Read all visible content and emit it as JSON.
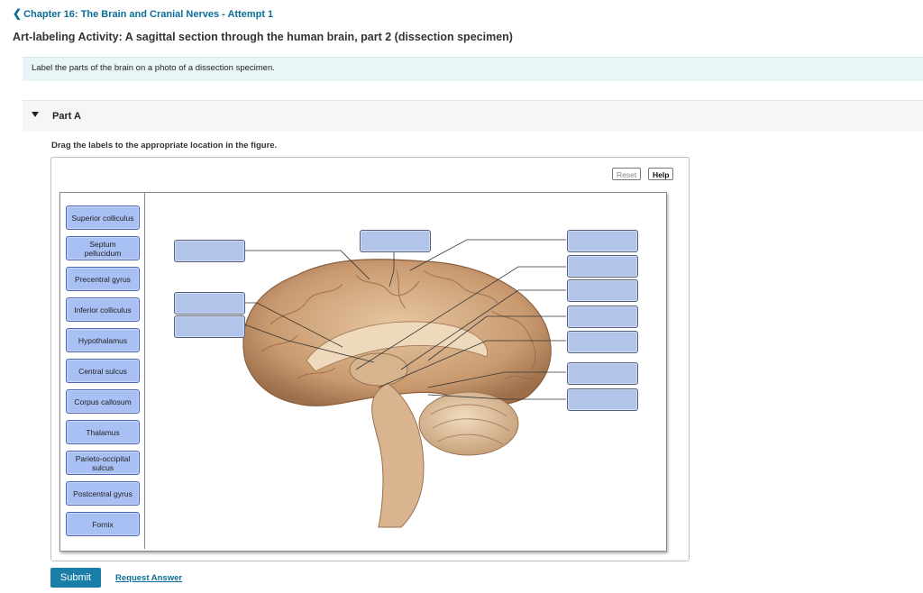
{
  "header": {
    "back_chevron": "❮",
    "chapter_link": "Chapter 16: The Brain and Cranial Nerves - Attempt 1",
    "activity_title": "Art-labeling Activity: A sagittal section through the human brain, part 2 (dissection specimen)"
  },
  "intro": "Label the parts of the brain on a photo of a dissection specimen.",
  "part": {
    "label": "Part A",
    "toggle_icon": "caret-down-icon",
    "instruction": "Drag the labels to the appropriate location in the figure."
  },
  "toolbar": {
    "reset_label": "Reset",
    "help_label": "Help"
  },
  "labels": [
    "Superior colliculus",
    "Septum pellucidum",
    "Precentral gyrus",
    "Inferior colliculus",
    "Hypothalamus",
    "Central sulcus",
    "Corpus callosum",
    "Thalamus",
    "Parieto-occipital sulcus",
    "Postcentral gyrus",
    "Fornix"
  ],
  "figure": {
    "image": "sagittal-brain-dissection-photo",
    "drop_targets_count": 11
  },
  "footer": {
    "submit_label": "Submit",
    "request_label": "Request Answer"
  },
  "colors": {
    "accent": "#1a7ea6",
    "link": "#0b6e99",
    "label_fill": "#a8c0f4",
    "drop_target_fill": "#b3c4ea",
    "intro_bg": "#e9f5f6"
  }
}
